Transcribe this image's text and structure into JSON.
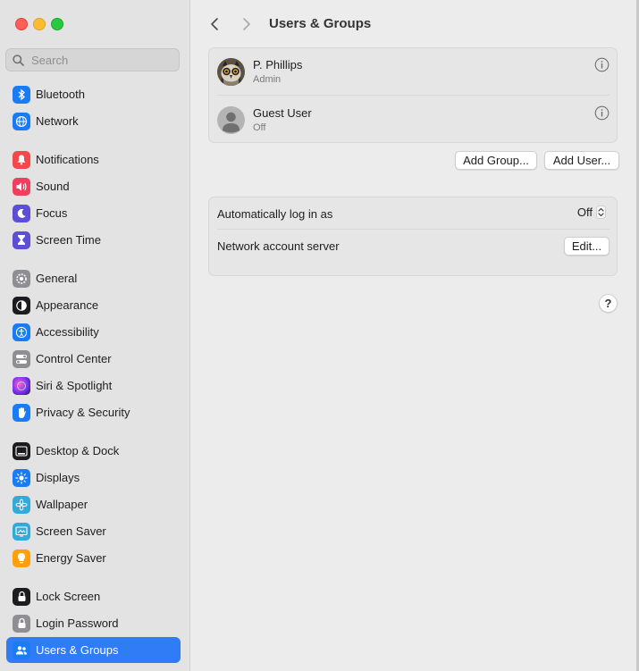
{
  "sidebar": {
    "search": {
      "placeholder": "Search",
      "value": ""
    },
    "items": [
      {
        "label": "Bluetooth",
        "icon": "bluetooth-icon",
        "color": "#1a7cf5"
      },
      {
        "label": "Network",
        "icon": "globe-icon",
        "color": "#1a7cf5"
      },
      {
        "label": "Notifications",
        "icon": "bell-icon",
        "color": "#f24a4a"
      },
      {
        "label": "Sound",
        "icon": "speaker-icon",
        "color": "#f03e5e"
      },
      {
        "label": "Focus",
        "icon": "moon-icon",
        "color": "#5b4fd6"
      },
      {
        "label": "Screen Time",
        "icon": "hourglass-icon",
        "color": "#5b4fd6"
      },
      {
        "label": "General",
        "icon": "gear-icon",
        "color": "#8e8e93"
      },
      {
        "label": "Appearance",
        "icon": "appearance-icon",
        "color": "#1c1c1e"
      },
      {
        "label": "Accessibility",
        "icon": "accessibility-icon",
        "color": "#1a7cf5"
      },
      {
        "label": "Control Center",
        "icon": "toggles-icon",
        "color": "#8e8e93"
      },
      {
        "label": "Siri & Spotlight",
        "icon": "siri-icon",
        "color": "#7b2ff7"
      },
      {
        "label": "Privacy & Security",
        "icon": "hand-icon",
        "color": "#1a7cf5"
      },
      {
        "label": "Desktop & Dock",
        "icon": "dock-icon",
        "color": "#1c1c1e"
      },
      {
        "label": "Displays",
        "icon": "sun-icon",
        "color": "#1a7cf5"
      },
      {
        "label": "Wallpaper",
        "icon": "flower-icon",
        "color": "#34aadc"
      },
      {
        "label": "Screen Saver",
        "icon": "screensaver-icon",
        "color": "#34aadc"
      },
      {
        "label": "Energy Saver",
        "icon": "bulb-icon",
        "color": "#ff9f0a"
      },
      {
        "label": "Lock Screen",
        "icon": "lock-icon",
        "color": "#1c1c1e"
      },
      {
        "label": "Login Password",
        "icon": "lock-icon",
        "color": "#8e8e93"
      },
      {
        "label": "Users & Groups",
        "icon": "users-icon",
        "color": "#1a7cf5",
        "active": true
      }
    ]
  },
  "main": {
    "title": "Users & Groups",
    "users": [
      {
        "name": "P. Phillips",
        "role": "Admin",
        "avatar": "owl-avatar"
      },
      {
        "name": "Guest User",
        "role": "Off",
        "avatar": "default-avatar"
      }
    ],
    "buttons": {
      "add_group": "Add Group...",
      "add_user": "Add User..."
    },
    "settings": {
      "auto_login_label": "Automatically log in as",
      "auto_login_value": "Off",
      "network_server_label": "Network account server",
      "edit_label": "Edit..."
    },
    "help_label": "?"
  },
  "colors": {
    "accent": "#2f7cf6",
    "sidebar_bg": "#e3e3e3",
    "window_bg": "#ececec"
  }
}
